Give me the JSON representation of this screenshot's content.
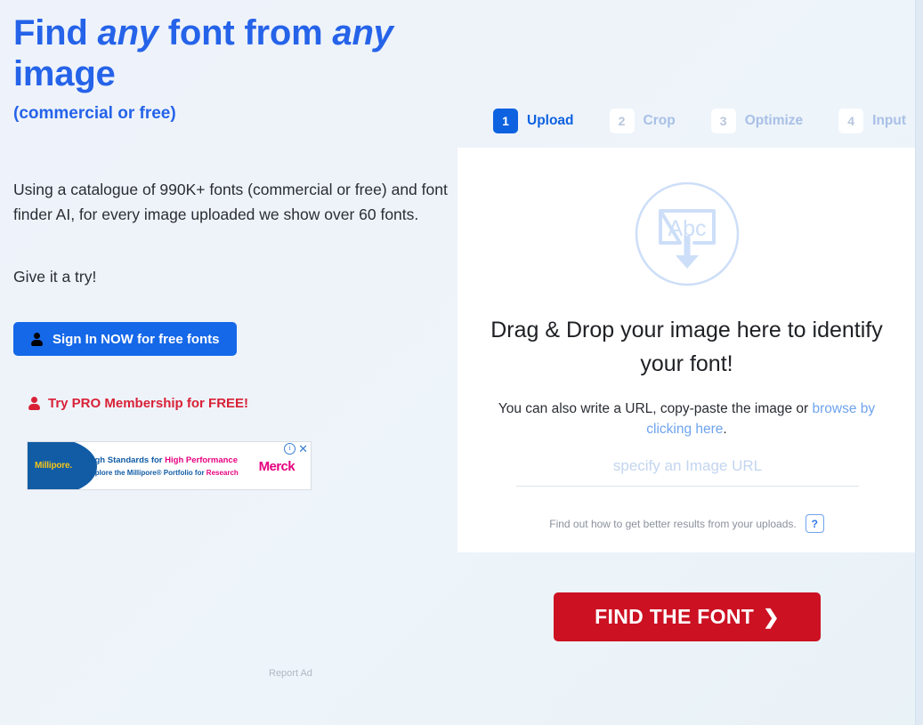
{
  "hero": {
    "title_part1": "Find ",
    "title_italic1": "any",
    "title_part2": " font from ",
    "title_italic2": "any",
    "title_part3": " image",
    "subtitle": "(commercial or free)",
    "body": "Using a catalogue of 990K+ fonts (commercial or free) and font finder AI, for every image uploaded we show over 60 fonts.",
    "body2": "Give it a try!",
    "signin_label": "Sign In NOW for free fonts",
    "pro_label": "Try PRO Membership for FREE!",
    "accent_blue": "#2563e9",
    "accent_red": "#d92136"
  },
  "ad": {
    "brand_logo": "Millipore.",
    "line1_a": "High Standards for ",
    "line1_b": "High Performance",
    "line2_a": "Explore the Millipore® Portfolio for ",
    "line2_b": "Research",
    "advertiser": "Merck",
    "info_icon": "i",
    "close_icon": "✕",
    "report_label": "Report Ad"
  },
  "steps": [
    {
      "num": "1",
      "label": "Upload",
      "state": "active"
    },
    {
      "num": "2",
      "label": "Crop",
      "state": "inactive"
    },
    {
      "num": "3",
      "label": "Optimize",
      "state": "inactive"
    },
    {
      "num": "4",
      "label": "Input",
      "state": "inactive"
    }
  ],
  "upload": {
    "icon_text": "Abc",
    "dropzone_title": "Drag & Drop your image here to identify your font!",
    "sub_text_before": "You can also write a URL, copy-paste the image or ",
    "sub_link": "browse by clicking here",
    "sub_text_after": ".",
    "url_placeholder": "specify an Image URL",
    "url_value": "",
    "helper_text": "Find out how to get better results from your uploads.",
    "help_badge": "?"
  },
  "cta": {
    "label": "FIND THE FONT",
    "chevron": "❯",
    "color": "#cc1122"
  }
}
